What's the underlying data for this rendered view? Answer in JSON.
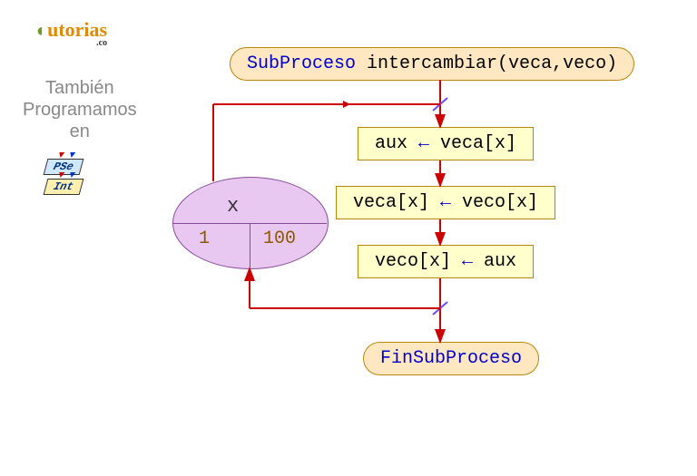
{
  "logo": {
    "text1": "utorias",
    "suffix": ".co"
  },
  "sidebar": {
    "line1": "También",
    "line2": "Programamos",
    "line3": "en",
    "badge1": "PSe",
    "badge2": "Int"
  },
  "flowchart": {
    "start_keyword": "SubProceso",
    "start_signature": " intercambiar(veca,veco)",
    "loop": {
      "variable": "x",
      "from": "1",
      "to": "100"
    },
    "step1": {
      "lhs": "aux ",
      "op": "←",
      "rhs": " veca[x]"
    },
    "step2": {
      "lhs": "veca[x] ",
      "op": "←",
      "rhs": " veco[x]"
    },
    "step3": {
      "lhs": "veco[x] ",
      "op": "←",
      "rhs": " aux"
    },
    "end_keyword": "FinSubProceso"
  }
}
